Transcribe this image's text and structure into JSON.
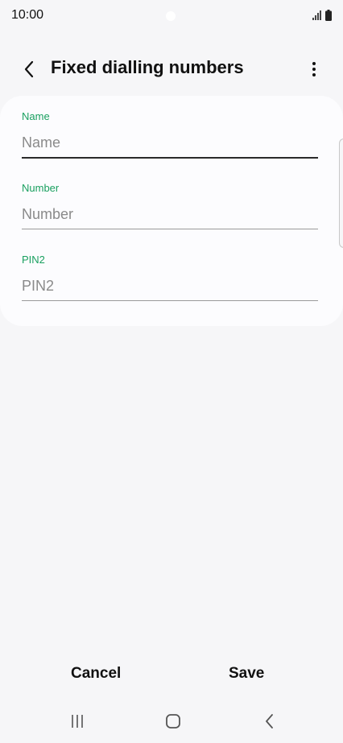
{
  "status_bar": {
    "time": "10:00",
    "icons": [
      "camera-dot",
      "signal-icon",
      "battery-icon"
    ]
  },
  "header": {
    "title": "Fixed dialling numbers",
    "back_icon": "chevron-left-icon",
    "more_icon": "more-vertical-icon"
  },
  "form": {
    "fields": [
      {
        "label": "Name",
        "placeholder": "Name",
        "value": "",
        "focused": true
      },
      {
        "label": "Number",
        "placeholder": "Number",
        "value": "",
        "focused": false
      },
      {
        "label": "PIN2",
        "placeholder": "PIN2",
        "value": "",
        "focused": false
      }
    ]
  },
  "actions": {
    "cancel_label": "Cancel",
    "save_label": "Save"
  },
  "nav_bar": {
    "icons": [
      "recents-icon",
      "home-icon",
      "back-icon"
    ]
  },
  "colors": {
    "background": "#f6f6f8",
    "card": "#fcfcfe",
    "accent_green": "#1aa060",
    "text": "#111111",
    "placeholder": "#8a8a8a"
  }
}
